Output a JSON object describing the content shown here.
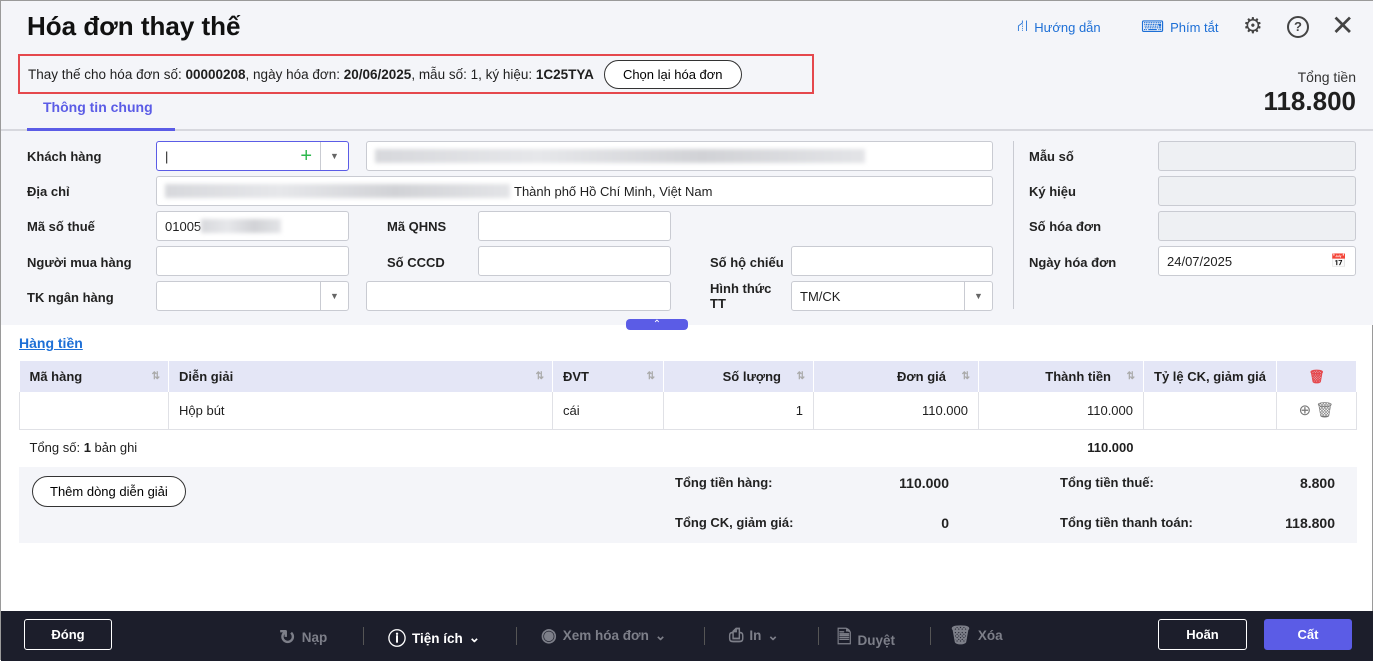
{
  "header": {
    "title": "Hóa đơn thay thế",
    "guide": "Hướng dẫn",
    "shortcuts": "Phím tắt",
    "total_label": "Tổng tiền",
    "total_value": "118.800"
  },
  "replace_info": {
    "prefix": "Thay thế cho hóa đơn số: ",
    "invoice_no": "00000208",
    "date_label": ", ngày hóa đơn: ",
    "date": "20/06/2025",
    "form_label": ", mẫu số: 1, ký hiệu: ",
    "symbol": "1C25TYA",
    "reselect_button": "Chọn lại hóa đơn"
  },
  "tabs": [
    {
      "label": "Thông tin chung",
      "active": true
    }
  ],
  "form": {
    "customer_label": "Khách hàng",
    "customer_value": "",
    "address_label": "Địa chỉ",
    "address_value": "Thành phố Hồ Chí Minh, Việt Nam",
    "tax_label": "Mã số thuế",
    "tax_value": "01005",
    "qhns_label": "Mã QHNS",
    "buyer_label": "Người mua hàng",
    "cccd_label": "Số CCCD",
    "passport_label": "Số hộ chiếu",
    "bank_label": "TK ngân hàng",
    "payment_label": "Hình thức TT",
    "payment_value": "TM/CK",
    "form_no_label": "Mẫu số",
    "symbol_label": "Ký hiệu",
    "invoice_no_label": "Số hóa đơn",
    "invoice_date_label": "Ngày hóa đơn",
    "invoice_date_value": "24/07/2025"
  },
  "items": {
    "section_title": "Hàng tiền",
    "columns": [
      "Mã hàng",
      "Diễn giải",
      "ĐVT",
      "Số lượng",
      "Đơn giá",
      "Thành tiền",
      "Tỷ lệ CK, giảm giá"
    ],
    "rows": [
      {
        "code": "",
        "desc": "Hộp bút",
        "unit": "cái",
        "qty": "1",
        "price": "110.000",
        "amount": "110.000",
        "discount": ""
      }
    ],
    "count_prefix": "Tổng số: ",
    "count": "1",
    "count_suffix": " bản ghi",
    "total_amount": "110.000"
  },
  "summary": {
    "add_line_button": "Thêm dòng diễn giải",
    "goods_label": "Tổng tiền hàng:",
    "goods_value": "110.000",
    "discount_label": "Tổng CK, giảm giá:",
    "discount_value": "0",
    "tax_label": "Tổng tiền thuế:",
    "tax_value": "8.800",
    "pay_label": "Tổng tiền thanh toán:",
    "pay_value": "118.800"
  },
  "footer": {
    "close": "Đóng",
    "reload": "Nạp",
    "utilities": "Tiện ích",
    "view": "Xem hóa đơn",
    "print": "In",
    "approve": "Duyệt",
    "delete": "Xóa",
    "cancel": "Hoãn",
    "save": "Cất"
  },
  "colors": {
    "accent": "#5b5ce6",
    "link": "#1d6fd6",
    "highlight": "#e5484d",
    "footer_bg": "#1c1e2b"
  }
}
